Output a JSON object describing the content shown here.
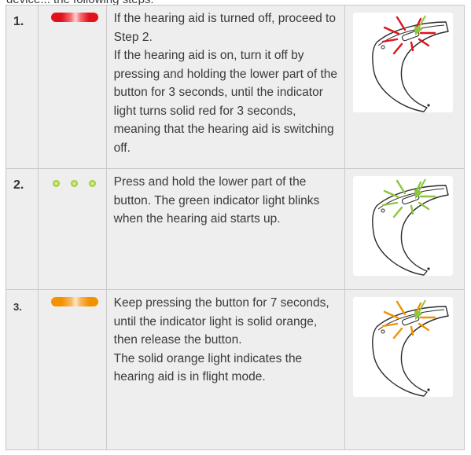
{
  "top_cut_text": "device... the following steps:",
  "steps": [
    {
      "number": "1.",
      "indicator": "red-solid-light",
      "indicator_color": "#e3111b",
      "paragraphs": [
        "If the hearing aid is turned off, proceed to Step 2.",
        "If the hearing aid is on, turn it off by pressing and holding the lower part of the button for 3 seconds, until the indicator light turns solid red for 3 seconds, meaning that the hearing aid is switching off."
      ],
      "illustration": "hearing-aid-red-light-illustration",
      "ray_color": "#e3111b",
      "arrow_color": "#8cc63f"
    },
    {
      "number": "2.",
      "indicator": "green-blinking-light",
      "indicator_color": "#a6cf3a",
      "paragraphs": [
        "Press and hold the lower part of the button. The green indicator light blinks when the hearing aid starts up."
      ],
      "illustration": "hearing-aid-green-light-illustration",
      "ray_color": "#8cc63f",
      "arrow_color": "#8cc63f"
    },
    {
      "number": "3.",
      "indicator": "orange-solid-light",
      "indicator_color": "#f39200",
      "paragraphs": [
        "Keep pressing the button for 7 seconds, until the indicator light is solid orange, then release the button.",
        "The solid orange light indicates the hearing aid is in flight mode."
      ],
      "illustration": "hearing-aid-orange-light-illustration",
      "ray_color": "#f39200",
      "arrow_color": "#8cc63f"
    }
  ]
}
